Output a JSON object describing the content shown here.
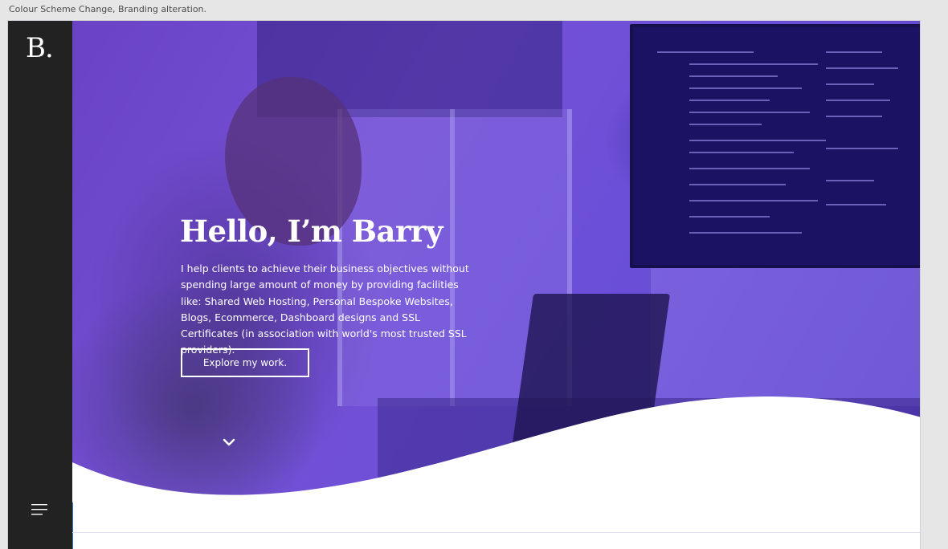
{
  "caption": "Colour Scheme Change, Branding alteration.",
  "sidebar": {
    "logo": "B.",
    "menu_icon": "hamburger-menu-icon"
  },
  "hero": {
    "title": "Hello, I’m Barry",
    "description": "I help clients to achieve their business objectives without spending large amount of money by providing facilities like: Shared Web Hosting, Personal Bespoke Websites, Blogs, Ecommerce, Dashboard designs and SSL Certificates (in association with world's most trusted SSL providers).",
    "cta_label": "Explore my work.",
    "scroll_icon": "chevron-down-icon"
  },
  "colors": {
    "sidebar": "#222222",
    "hero_overlay": "#6b4fd8",
    "text": "#ffffff",
    "page": "#ffffff"
  }
}
